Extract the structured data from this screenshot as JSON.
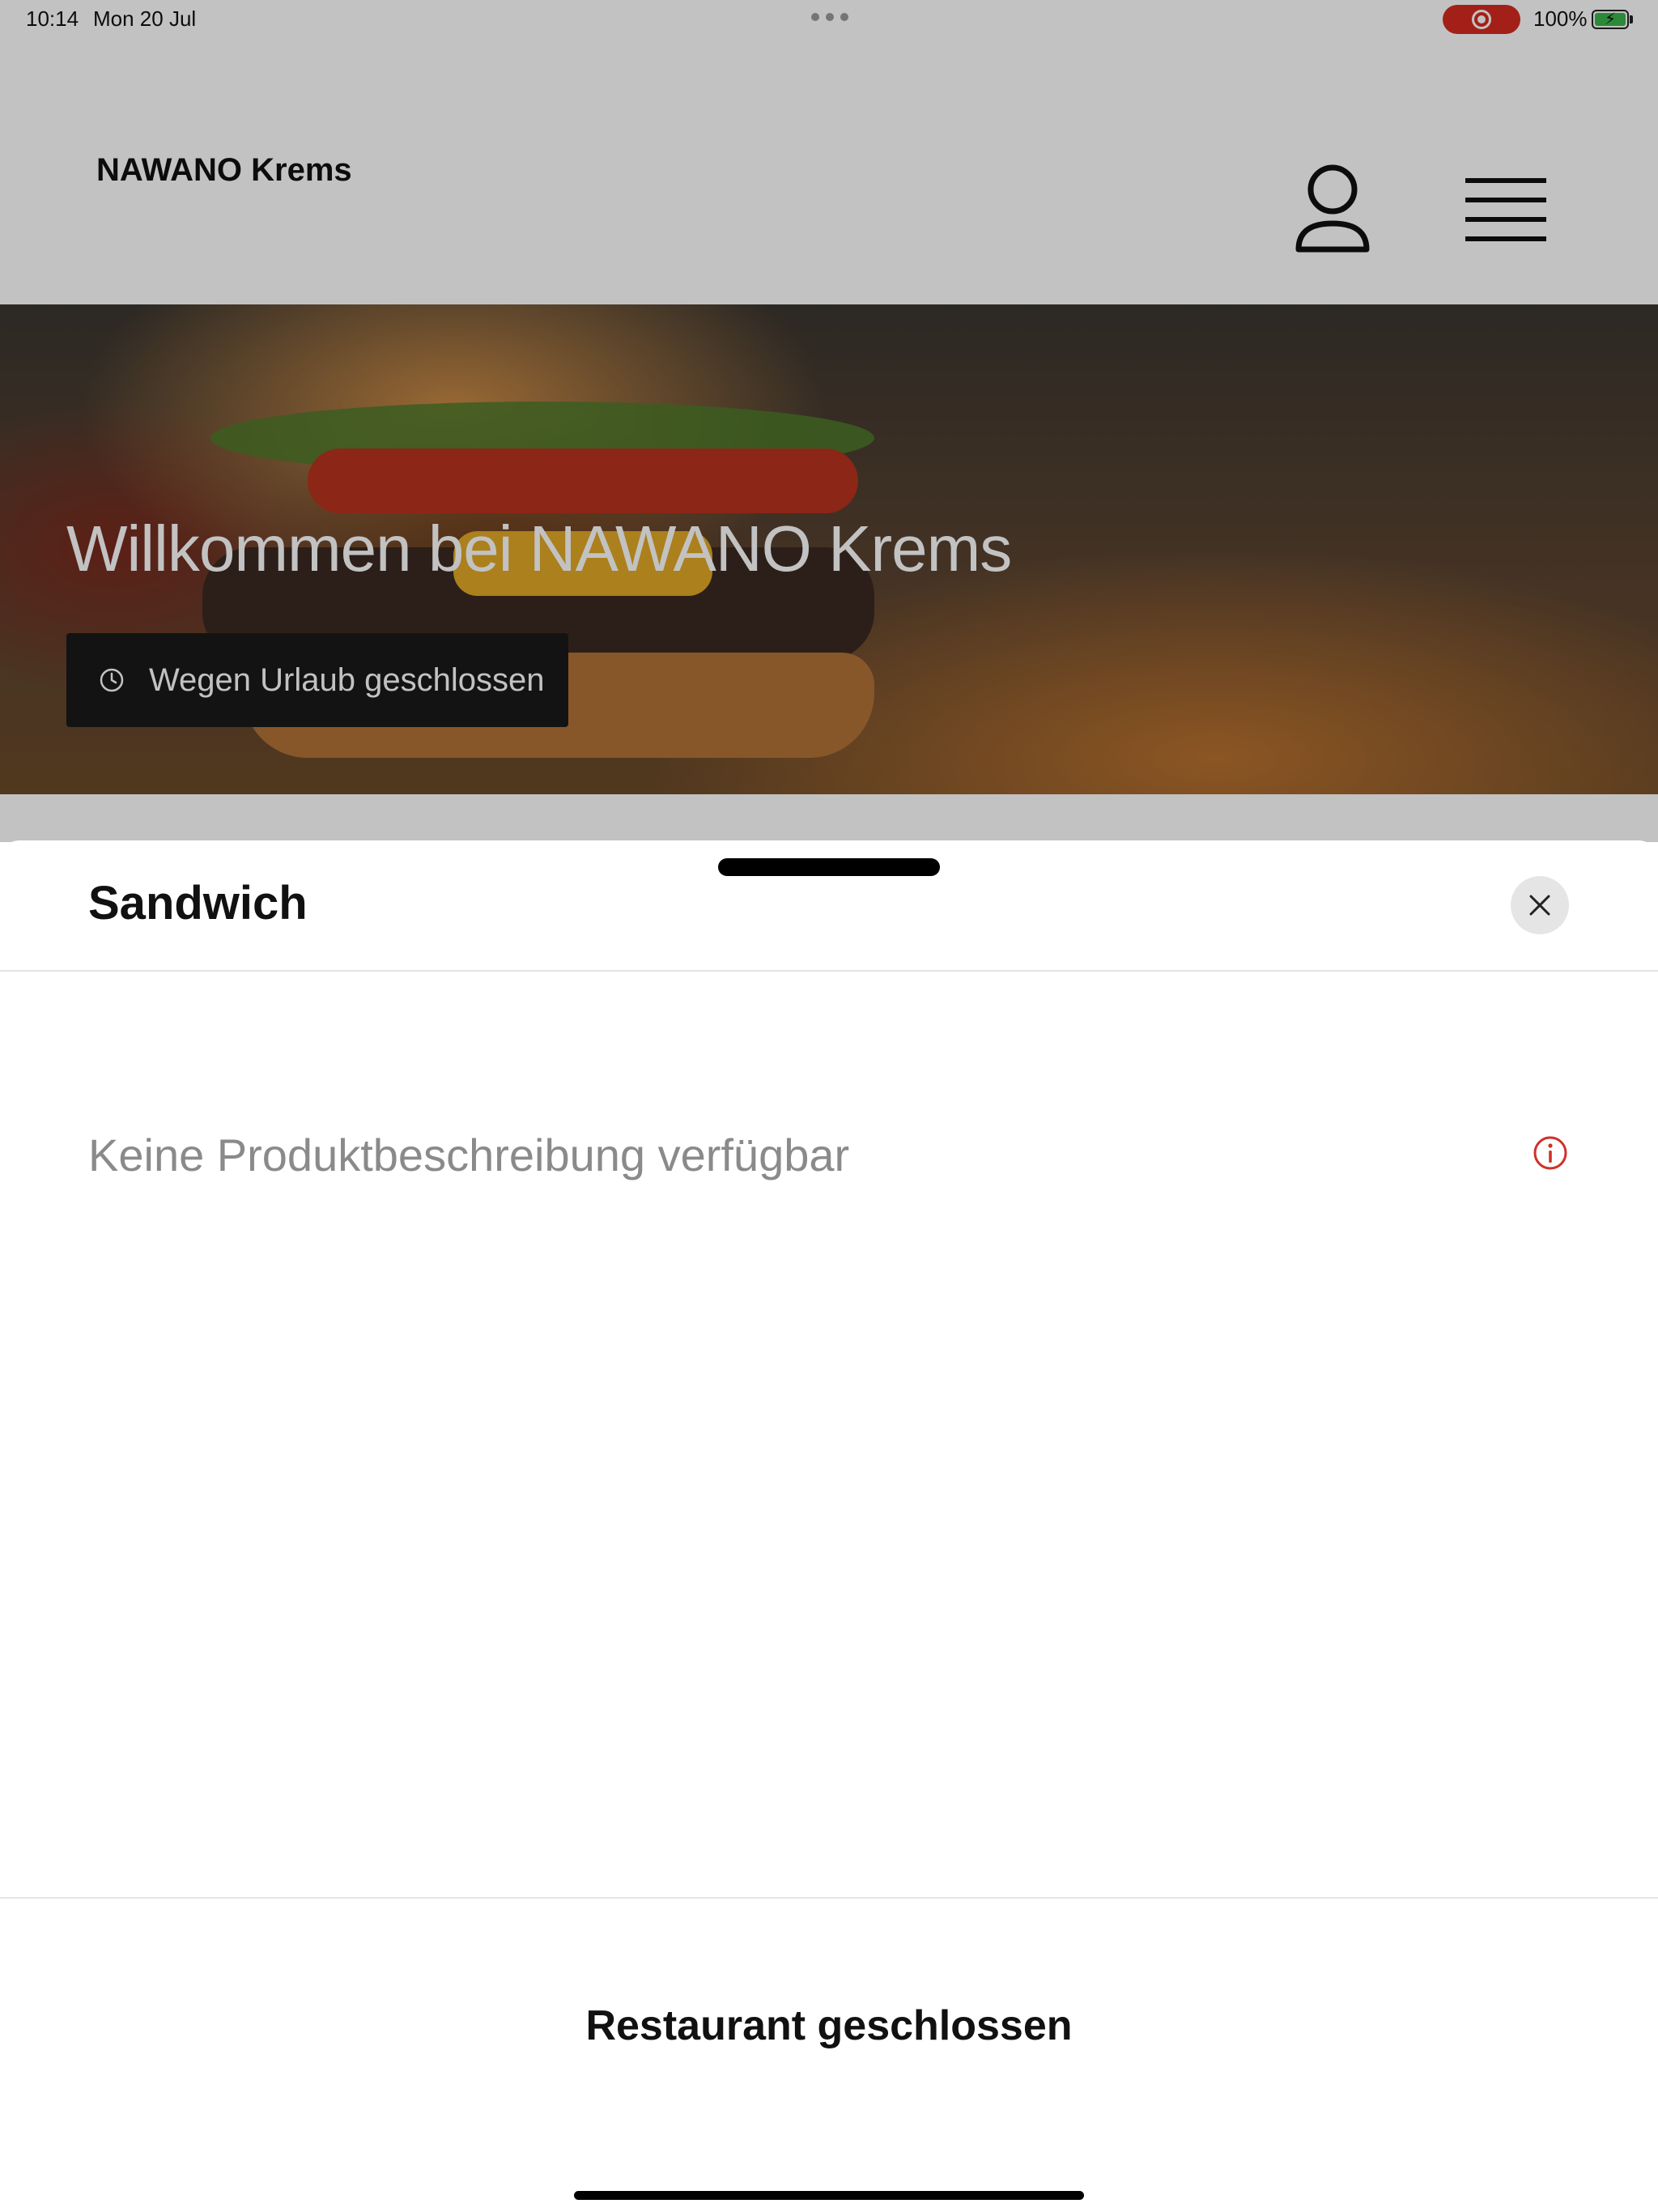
{
  "status_bar": {
    "time": "10:14",
    "date": "Mon 20 Jul",
    "battery_percent": "100%",
    "recording_color": "#d62b20",
    "battery_color": "#3ab54a"
  },
  "header": {
    "title": "NAWANO Krems",
    "account_icon": "person-icon",
    "menu_icon": "hamburger-menu-icon"
  },
  "hero": {
    "title": "Willkommen bei NAWANO Krems",
    "status_text": "Wegen Urlaub geschlossen",
    "status_icon": "clock-icon"
  },
  "sheet": {
    "title": "Sandwich",
    "close_icon": "close-icon",
    "description": "Keine Produktbeschreibung verfügbar",
    "info_icon": "info-icon",
    "info_color": "#d0302a",
    "footer_label": "Restaurant geschlossen"
  }
}
